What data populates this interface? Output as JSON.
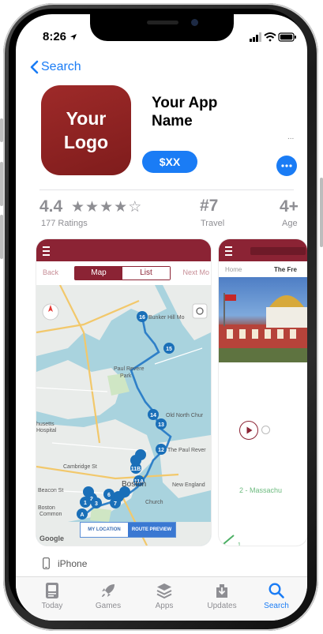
{
  "status_bar": {
    "time": "8:26"
  },
  "nav": {
    "back_label": "Search"
  },
  "app": {
    "icon_text": "Your\nLogo",
    "name": "Your App Name",
    "subtitle_more": "...",
    "price": "$XX"
  },
  "info": {
    "rating": "4.4",
    "stars_filled": 4.5,
    "ratings_count": "177 Ratings",
    "rank": "#7",
    "category": "Travel",
    "age": "4+",
    "age_label": "Age"
  },
  "screenshot1": {
    "back": "Back",
    "next": "Next Mo",
    "segment": [
      "Map",
      "List"
    ],
    "map_buttons": [
      "MY LOCATION",
      "ROUTE PREVIEW"
    ],
    "map_labels": [
      "Bunker Hill Mo",
      "Paul Revere Park",
      "Old North Chur",
      "The Paul Rever",
      "Church",
      "New England",
      "Boston",
      "husetts Hospital",
      "Common",
      "Beacon St",
      "Cambridge St",
      "Google"
    ],
    "markers": [
      "16",
      "15",
      "14",
      "13",
      "12",
      "11A",
      "11B",
      "10",
      "9",
      "8",
      "7",
      "6",
      "5",
      "4",
      "3",
      "2",
      "1",
      "A"
    ]
  },
  "screenshot2": {
    "tabs": [
      "Home",
      "The Fre"
    ],
    "caption": "2 - Massachu",
    "footer_label": "1"
  },
  "device": {
    "label": "iPhone"
  },
  "tabbar": {
    "items": [
      {
        "label": "Today",
        "icon": "today-icon"
      },
      {
        "label": "Games",
        "icon": "rocket-icon"
      },
      {
        "label": "Apps",
        "icon": "layers-icon"
      },
      {
        "label": "Updates",
        "icon": "download-icon"
      },
      {
        "label": "Search",
        "icon": "search-icon",
        "active": true
      }
    ]
  },
  "colors": {
    "accent": "#1a7cf5",
    "brand": "#8b2334",
    "icon_bg": "#9e2a29"
  }
}
